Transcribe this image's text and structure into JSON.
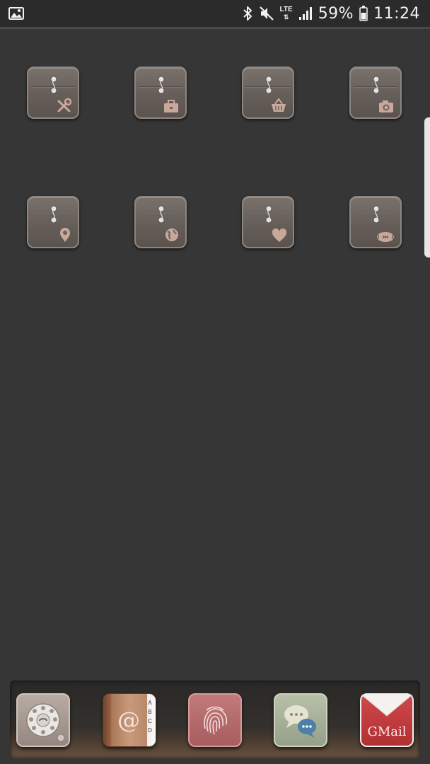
{
  "status_bar": {
    "notification_icon": "image-icon",
    "icons": [
      "bluetooth-icon",
      "mute-icon",
      "lte-icon",
      "signal-icon"
    ],
    "network_label": "LTE",
    "battery_percent": "59%",
    "battery_icon": "battery-icon",
    "time": "11:24"
  },
  "folders": [
    {
      "icon": "tools-icon"
    },
    {
      "icon": "briefcase-icon"
    },
    {
      "icon": "basket-icon"
    },
    {
      "icon": "camera-icon"
    },
    {
      "icon": "location-pin-icon"
    },
    {
      "icon": "globe-icon"
    },
    {
      "icon": "heart-icon"
    },
    {
      "icon": "football-icon"
    }
  ],
  "dock": {
    "apps": [
      {
        "icon": "rotary-phone-icon"
      },
      {
        "icon": "address-book-icon",
        "tabs": [
          "A",
          "B",
          "C",
          "D"
        ]
      },
      {
        "icon": "fingerprint-icon"
      },
      {
        "icon": "chat-bubbles-icon"
      },
      {
        "icon": "gmail-envelope-icon",
        "label": "GMail"
      }
    ]
  },
  "colors": {
    "background": "#363636",
    "folder": "#6b635e",
    "folder_glyph": "#c9a89a"
  }
}
